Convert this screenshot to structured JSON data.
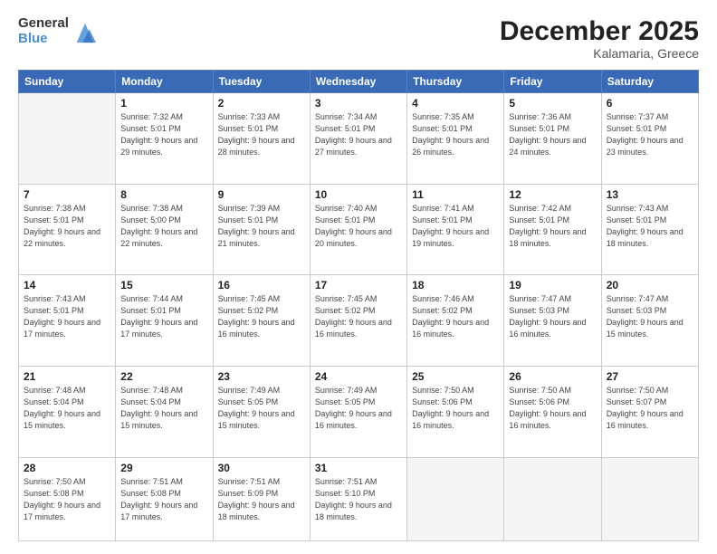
{
  "logo": {
    "general": "General",
    "blue": "Blue"
  },
  "header": {
    "month": "December 2025",
    "location": "Kalamaria, Greece"
  },
  "weekdays": [
    "Sunday",
    "Monday",
    "Tuesday",
    "Wednesday",
    "Thursday",
    "Friday",
    "Saturday"
  ],
  "weeks": [
    [
      {
        "day": "",
        "sunrise": "",
        "sunset": "",
        "daylight": "",
        "empty": true
      },
      {
        "day": "1",
        "sunrise": "Sunrise: 7:32 AM",
        "sunset": "Sunset: 5:01 PM",
        "daylight": "Daylight: 9 hours and 29 minutes."
      },
      {
        "day": "2",
        "sunrise": "Sunrise: 7:33 AM",
        "sunset": "Sunset: 5:01 PM",
        "daylight": "Daylight: 9 hours and 28 minutes."
      },
      {
        "day": "3",
        "sunrise": "Sunrise: 7:34 AM",
        "sunset": "Sunset: 5:01 PM",
        "daylight": "Daylight: 9 hours and 27 minutes."
      },
      {
        "day": "4",
        "sunrise": "Sunrise: 7:35 AM",
        "sunset": "Sunset: 5:01 PM",
        "daylight": "Daylight: 9 hours and 26 minutes."
      },
      {
        "day": "5",
        "sunrise": "Sunrise: 7:36 AM",
        "sunset": "Sunset: 5:01 PM",
        "daylight": "Daylight: 9 hours and 24 minutes."
      },
      {
        "day": "6",
        "sunrise": "Sunrise: 7:37 AM",
        "sunset": "Sunset: 5:01 PM",
        "daylight": "Daylight: 9 hours and 23 minutes."
      }
    ],
    [
      {
        "day": "7",
        "sunrise": "Sunrise: 7:38 AM",
        "sunset": "Sunset: 5:01 PM",
        "daylight": "Daylight: 9 hours and 22 minutes."
      },
      {
        "day": "8",
        "sunrise": "Sunrise: 7:38 AM",
        "sunset": "Sunset: 5:00 PM",
        "daylight": "Daylight: 9 hours and 22 minutes."
      },
      {
        "day": "9",
        "sunrise": "Sunrise: 7:39 AM",
        "sunset": "Sunset: 5:01 PM",
        "daylight": "Daylight: 9 hours and 21 minutes."
      },
      {
        "day": "10",
        "sunrise": "Sunrise: 7:40 AM",
        "sunset": "Sunset: 5:01 PM",
        "daylight": "Daylight: 9 hours and 20 minutes."
      },
      {
        "day": "11",
        "sunrise": "Sunrise: 7:41 AM",
        "sunset": "Sunset: 5:01 PM",
        "daylight": "Daylight: 9 hours and 19 minutes."
      },
      {
        "day": "12",
        "sunrise": "Sunrise: 7:42 AM",
        "sunset": "Sunset: 5:01 PM",
        "daylight": "Daylight: 9 hours and 18 minutes."
      },
      {
        "day": "13",
        "sunrise": "Sunrise: 7:43 AM",
        "sunset": "Sunset: 5:01 PM",
        "daylight": "Daylight: 9 hours and 18 minutes."
      }
    ],
    [
      {
        "day": "14",
        "sunrise": "Sunrise: 7:43 AM",
        "sunset": "Sunset: 5:01 PM",
        "daylight": "Daylight: 9 hours and 17 minutes."
      },
      {
        "day": "15",
        "sunrise": "Sunrise: 7:44 AM",
        "sunset": "Sunset: 5:01 PM",
        "daylight": "Daylight: 9 hours and 17 minutes."
      },
      {
        "day": "16",
        "sunrise": "Sunrise: 7:45 AM",
        "sunset": "Sunset: 5:02 PM",
        "daylight": "Daylight: 9 hours and 16 minutes."
      },
      {
        "day": "17",
        "sunrise": "Sunrise: 7:45 AM",
        "sunset": "Sunset: 5:02 PM",
        "daylight": "Daylight: 9 hours and 16 minutes."
      },
      {
        "day": "18",
        "sunrise": "Sunrise: 7:46 AM",
        "sunset": "Sunset: 5:02 PM",
        "daylight": "Daylight: 9 hours and 16 minutes."
      },
      {
        "day": "19",
        "sunrise": "Sunrise: 7:47 AM",
        "sunset": "Sunset: 5:03 PM",
        "daylight": "Daylight: 9 hours and 16 minutes."
      },
      {
        "day": "20",
        "sunrise": "Sunrise: 7:47 AM",
        "sunset": "Sunset: 5:03 PM",
        "daylight": "Daylight: 9 hours and 15 minutes."
      }
    ],
    [
      {
        "day": "21",
        "sunrise": "Sunrise: 7:48 AM",
        "sunset": "Sunset: 5:04 PM",
        "daylight": "Daylight: 9 hours and 15 minutes."
      },
      {
        "day": "22",
        "sunrise": "Sunrise: 7:48 AM",
        "sunset": "Sunset: 5:04 PM",
        "daylight": "Daylight: 9 hours and 15 minutes."
      },
      {
        "day": "23",
        "sunrise": "Sunrise: 7:49 AM",
        "sunset": "Sunset: 5:05 PM",
        "daylight": "Daylight: 9 hours and 15 minutes."
      },
      {
        "day": "24",
        "sunrise": "Sunrise: 7:49 AM",
        "sunset": "Sunset: 5:05 PM",
        "daylight": "Daylight: 9 hours and 16 minutes."
      },
      {
        "day": "25",
        "sunrise": "Sunrise: 7:50 AM",
        "sunset": "Sunset: 5:06 PM",
        "daylight": "Daylight: 9 hours and 16 minutes."
      },
      {
        "day": "26",
        "sunrise": "Sunrise: 7:50 AM",
        "sunset": "Sunset: 5:06 PM",
        "daylight": "Daylight: 9 hours and 16 minutes."
      },
      {
        "day": "27",
        "sunrise": "Sunrise: 7:50 AM",
        "sunset": "Sunset: 5:07 PM",
        "daylight": "Daylight: 9 hours and 16 minutes."
      }
    ],
    [
      {
        "day": "28",
        "sunrise": "Sunrise: 7:50 AM",
        "sunset": "Sunset: 5:08 PM",
        "daylight": "Daylight: 9 hours and 17 minutes."
      },
      {
        "day": "29",
        "sunrise": "Sunrise: 7:51 AM",
        "sunset": "Sunset: 5:08 PM",
        "daylight": "Daylight: 9 hours and 17 minutes."
      },
      {
        "day": "30",
        "sunrise": "Sunrise: 7:51 AM",
        "sunset": "Sunset: 5:09 PM",
        "daylight": "Daylight: 9 hours and 18 minutes."
      },
      {
        "day": "31",
        "sunrise": "Sunrise: 7:51 AM",
        "sunset": "Sunset: 5:10 PM",
        "daylight": "Daylight: 9 hours and 18 minutes."
      },
      {
        "day": "",
        "empty": true
      },
      {
        "day": "",
        "empty": true
      },
      {
        "day": "",
        "empty": true
      }
    ]
  ]
}
